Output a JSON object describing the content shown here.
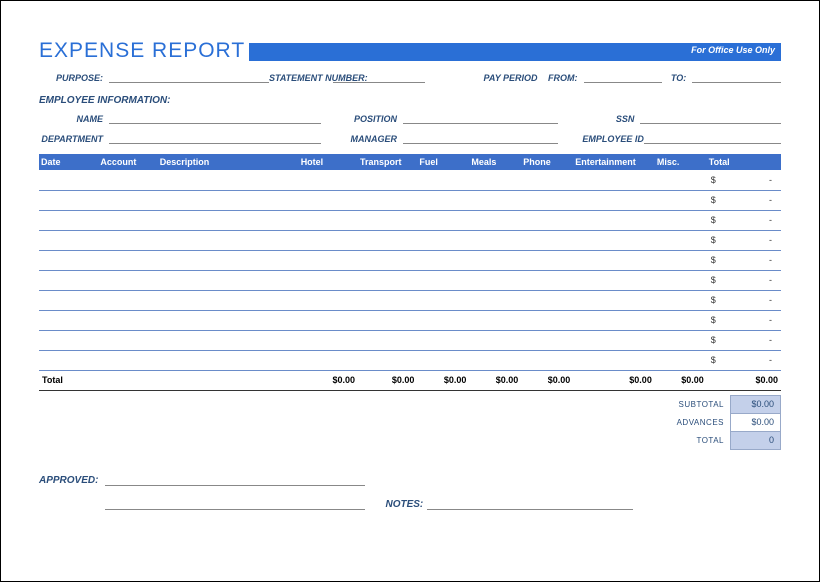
{
  "title": "EXPENSE REPORT",
  "office_use": "For Office Use Only",
  "header_fields": {
    "purpose": "PURPOSE:",
    "statement_number": "STATEMENT NUMBER:",
    "pay_period": "PAY PERIOD",
    "from": "FROM:",
    "to": "TO:"
  },
  "employee_section": "EMPLOYEE INFORMATION:",
  "emp_fields": {
    "name": "NAME",
    "position": "POSITION",
    "ssn": "SSN",
    "department": "DEPARTMENT",
    "manager": "MANAGER",
    "employee_id": "EMPLOYEE ID"
  },
  "columns": [
    "Date",
    "Account",
    "Description",
    "Hotel",
    "Transport",
    "Fuel",
    "Meals",
    "Phone",
    "Entertainment",
    "Misc.",
    "Total"
  ],
  "rows": [
    {
      "total_sym": "$",
      "total_val": "-"
    },
    {
      "total_sym": "$",
      "total_val": "-"
    },
    {
      "total_sym": "$",
      "total_val": "-"
    },
    {
      "total_sym": "$",
      "total_val": "-"
    },
    {
      "total_sym": "$",
      "total_val": "-"
    },
    {
      "total_sym": "$",
      "total_val": "-"
    },
    {
      "total_sym": "$",
      "total_val": "-"
    },
    {
      "total_sym": "$",
      "total_val": "-"
    },
    {
      "total_sym": "$",
      "total_val": "-"
    },
    {
      "total_sym": "$",
      "total_val": "-"
    }
  ],
  "totals_row": {
    "label": "Total",
    "hotel": "$0.00",
    "transport": "$0.00",
    "fuel": "$0.00",
    "meals": "$0.00",
    "phone": "$0.00",
    "entertainment": "$0.00",
    "misc": "$0.00",
    "total": "$0.00"
  },
  "summary": {
    "subtotal_label": "SUBTOTAL",
    "subtotal": "$0.00",
    "advances_label": "ADVANCES",
    "advances": "$0.00",
    "total_label": "TOTAL",
    "total": "0"
  },
  "footer": {
    "approved": "APPROVED:",
    "notes": "NOTES:"
  }
}
